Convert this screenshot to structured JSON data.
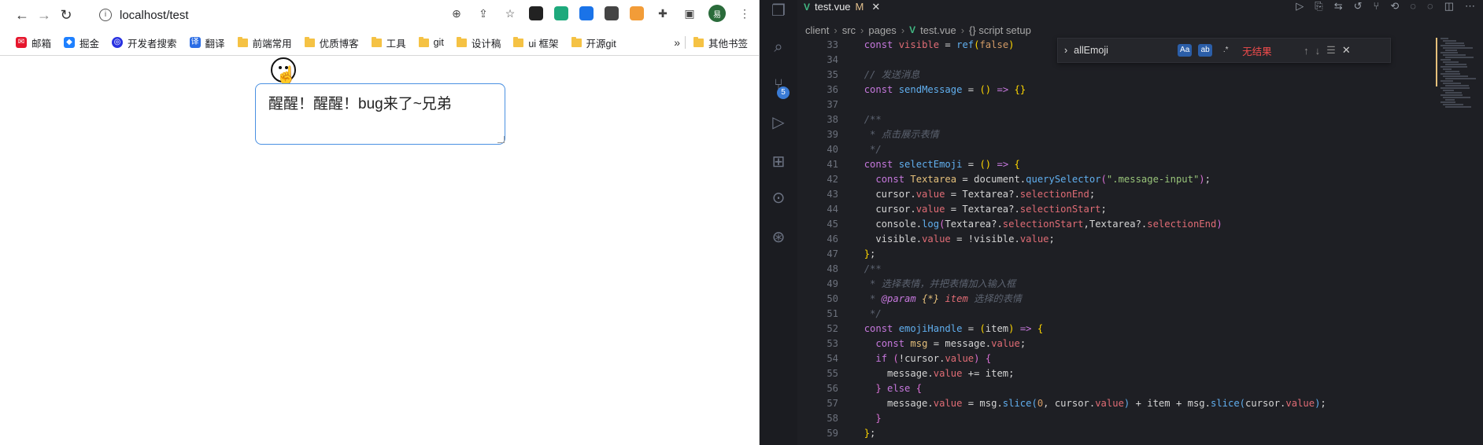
{
  "browser": {
    "url": "localhost/test",
    "nav": {
      "back": "←",
      "forward": "→",
      "reload": "↻"
    },
    "avatar_letter": "易",
    "bookmarks": [
      {
        "label": "邮箱",
        "icon": "weibo-icon",
        "color": "#e6162d"
      },
      {
        "label": "掘金",
        "icon": "juejin-icon",
        "color": "#1e80ff"
      },
      {
        "label": "开发者搜索",
        "icon": "search-dev-icon",
        "color": "#2932e1"
      },
      {
        "label": "翻译",
        "icon": "translate-icon",
        "color": "#2b6de5"
      },
      {
        "label": "前端常用",
        "icon": "folder-icon"
      },
      {
        "label": "优质博客",
        "icon": "folder-icon"
      },
      {
        "label": "工具",
        "icon": "folder-icon"
      },
      {
        "label": "git",
        "icon": "folder-icon"
      },
      {
        "label": "设计稿",
        "icon": "folder-icon"
      },
      {
        "label": "ui 框架",
        "icon": "folder-icon"
      },
      {
        "label": "开源git",
        "icon": "folder-icon"
      }
    ],
    "more": "»",
    "other_bookmarks": "其他书签",
    "textarea_value": "醒醒！醒醒！bug来了~兄弟"
  },
  "vscode": {
    "tab_label": "test.vue",
    "tab_status": "M",
    "breadcrumbs": [
      "client",
      "src",
      "pages",
      "test.vue",
      "{} script setup"
    ],
    "scm_badge": "5",
    "find": {
      "query": "allEmoji",
      "opt_case": "Aa",
      "opt_word": "ab",
      "opt_regex": ".*",
      "result": "无结果"
    },
    "lines": [
      {
        "n": "33",
        "html": "<span class='kw'>const</span> <span class='vr'>visible</span> = <span class='fn'>ref</span><span class='br'>(</span><span class='nm'>false</span><span class='br'>)</span>"
      },
      {
        "n": "34",
        "html": ""
      },
      {
        "n": "35",
        "html": "<span class='cm'>// 发送消息</span>"
      },
      {
        "n": "36",
        "html": "<span class='kw'>const</span> <span class='fn'>sendMessage</span> = <span class='br'>()</span> <span class='kw'>=&gt;</span> <span class='br'>{}</span>"
      },
      {
        "n": "37",
        "html": ""
      },
      {
        "n": "38",
        "html": "<span class='cm'>/**</span>"
      },
      {
        "n": "39",
        "html": "<span class='cm'> * 点击展示表情</span>"
      },
      {
        "n": "40",
        "html": "<span class='cm'> */</span>"
      },
      {
        "n": "41",
        "html": "<span class='kw'>const</span> <span class='fn'>selectEmoji</span> = <span class='br'>()</span> <span class='kw'>=&gt;</span> <span class='br'>{</span>"
      },
      {
        "n": "42",
        "html": "  <span class='kw'>const</span> <span class='cn'>Textarea</span> = document.<span class='fn'>querySelector</span><span class='br2'>(</span><span class='st'>\".message-input\"</span><span class='br2'>)</span>;"
      },
      {
        "n": "43",
        "html": "  cursor.<span class='vr'>value</span> = Textarea?.<span class='vr'>selectionEnd</span>;"
      },
      {
        "n": "44",
        "html": "  cursor.<span class='vr'>value</span> = Textarea?.<span class='vr'>selectionStart</span>;"
      },
      {
        "n": "45",
        "html": "  console.<span class='fn'>log</span><span class='br2'>(</span>Textarea?.<span class='vr'>selectionStart</span>,Textarea?.<span class='vr'>selectionEnd</span><span class='br2'>)</span>"
      },
      {
        "n": "46",
        "html": "  visible.<span class='vr'>value</span> = !visible.<span class='vr'>value</span>;"
      },
      {
        "n": "47",
        "html": "<span class='br'>}</span>;"
      },
      {
        "n": "48",
        "html": "<span class='cm'>/**</span>"
      },
      {
        "n": "49",
        "html": "<span class='cm'> * 选择表情，并把表情加入输入框</span>"
      },
      {
        "n": "50",
        "html": "<span class='cm'> * </span><span class='kw' style='font-style:italic'>@param</span> <span class='cn' style='font-style:italic'>{*}</span> <span class='vr' style='font-style:italic'>item</span><span class='cm'> 选择的表情</span>"
      },
      {
        "n": "51",
        "html": "<span class='cm'> */</span>"
      },
      {
        "n": "52",
        "html": "<span class='kw'>const</span> <span class='fn'>emojiHandle</span> = <span class='br'>(</span>item<span class='br'>)</span> <span class='kw'>=&gt;</span> <span class='br'>{</span>"
      },
      {
        "n": "53",
        "html": "  <span class='kw'>const</span> <span class='cn'>msg</span> = message.<span class='vr'>value</span>;"
      },
      {
        "n": "54",
        "html": "  <span class='kw'>if</span> <span class='br2'>(</span>!cursor.<span class='vr'>value</span><span class='br2'>)</span> <span class='br2'>{</span>"
      },
      {
        "n": "55",
        "html": "    message.<span class='vr'>value</span> += item;"
      },
      {
        "n": "56",
        "html": "  <span class='br2'>}</span> <span class='kw'>else</span> <span class='br2'>{</span>"
      },
      {
        "n": "57",
        "html": "    message.<span class='vr'>value</span> = msg.<span class='fn'>slice</span><span class='fn'>(</span><span class='nm'>0</span>, cursor.<span class='vr'>value</span><span class='fn'>)</span> + item + msg.<span class='fn'>slice</span><span class='fn'>(</span>cursor.<span class='vr'>value</span><span class='fn'>)</span>;"
      },
      {
        "n": "58",
        "html": "  <span class='br2'>}</span>"
      },
      {
        "n": "59",
        "html": "<span class='br'>}</span>;"
      }
    ]
  }
}
